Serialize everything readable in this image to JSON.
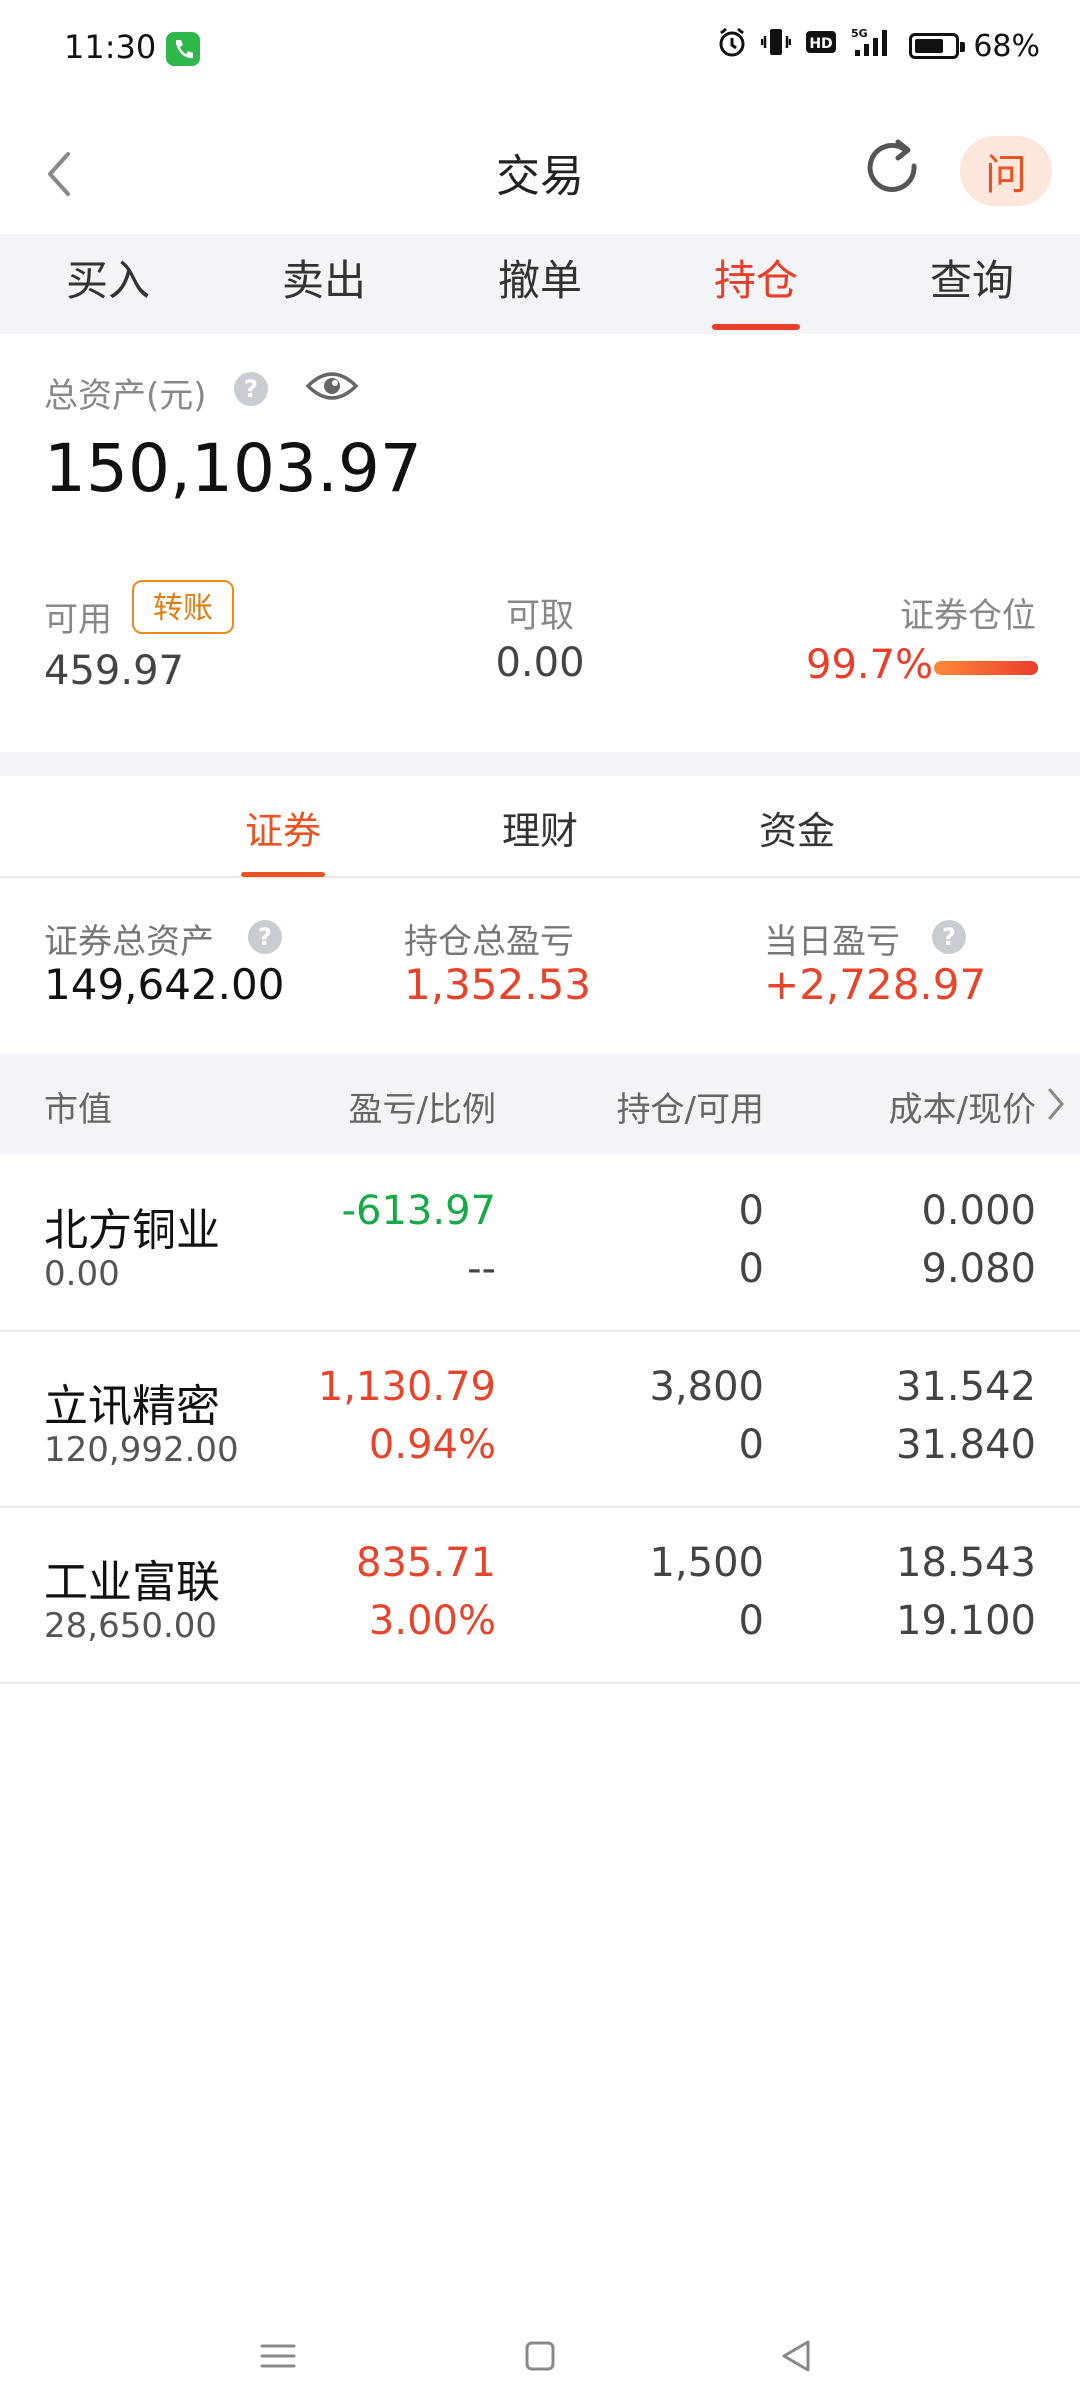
{
  "status_bar": {
    "time": "11:30",
    "battery": "68%",
    "icons": [
      "phone-call-icon",
      "alarm-icon",
      "vibrate-icon",
      "hd-icon",
      "signal-5g-icon",
      "battery-icon"
    ]
  },
  "header": {
    "title": "交易",
    "ask_label": "问"
  },
  "tabs": [
    {
      "label": "买入"
    },
    {
      "label": "卖出"
    },
    {
      "label": "撤单"
    },
    {
      "label": "持仓",
      "active": true
    },
    {
      "label": "查询"
    }
  ],
  "assets": {
    "total_label": "总资产(元)",
    "total_value": "150,103.97",
    "available_label": "可用",
    "transfer_label": "转账",
    "available_value": "459.97",
    "withdrawable_label": "可取",
    "withdrawable_value": "0.00",
    "position_label": "证券仓位",
    "position_value": "99.7%",
    "position_level": 0.997
  },
  "subtabs": [
    {
      "label": "证券",
      "active": true
    },
    {
      "label": "理财"
    },
    {
      "label": "资金"
    }
  ],
  "summary": {
    "securities_total_label": "证券总资产",
    "securities_total_value": "149,642.00",
    "holding_pl_label": "持仓总盈亏",
    "holding_pl_value": "1,352.53",
    "daily_pl_label": "当日盈亏",
    "daily_pl_value": "+2,728.97"
  },
  "table": {
    "columns": [
      "市值",
      "盈亏/比例",
      "持仓/可用",
      "成本/现价"
    ],
    "rows": [
      {
        "name": "北方铜业",
        "market_value": "0.00",
        "pl": "-613.97",
        "pl_ratio": "--",
        "holding": "0",
        "available": "0",
        "cost": "0.000",
        "price": "9.080",
        "pl_color": "#18a847"
      },
      {
        "name": "立讯精密",
        "market_value": "120,992.00",
        "pl": "1,130.79",
        "pl_ratio": "0.94%",
        "holding": "3,800",
        "available": "0",
        "cost": "31.542",
        "price": "31.840",
        "pl_color": "#e8432b"
      },
      {
        "name": "工业富联",
        "market_value": "28,650.00",
        "pl": "835.71",
        "pl_ratio": "3.00%",
        "holding": "1,500",
        "available": "0",
        "cost": "18.543",
        "price": "19.100",
        "pl_color": "#e8432b"
      }
    ]
  },
  "colors": {
    "accent": "#ea3d2a",
    "gain": "#e8432b",
    "loss": "#18a847"
  }
}
